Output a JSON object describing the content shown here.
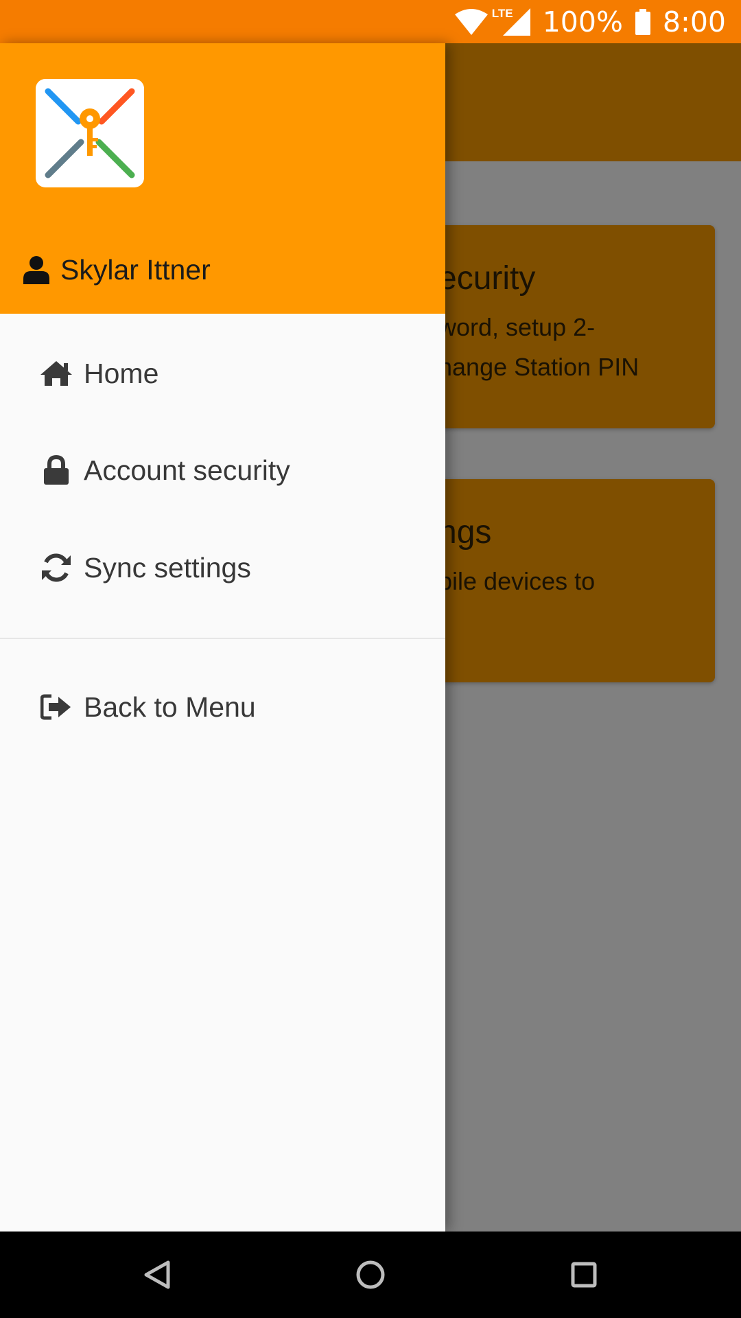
{
  "status_bar": {
    "battery_text": "100%",
    "time": "8:00",
    "network_label": "LTE",
    "icons": [
      "wifi-icon",
      "lte-signal-icon",
      "battery-icon"
    ]
  },
  "drawer": {
    "user_name": "Skylar Ittner",
    "items": [
      {
        "label": "Home",
        "icon": "home-icon"
      },
      {
        "label": "Account security",
        "icon": "lock-icon"
      },
      {
        "label": "Sync settings",
        "icon": "sync-icon"
      }
    ],
    "footer_items": [
      {
        "label": "Back to Menu",
        "icon": "sign-out-icon"
      }
    ]
  },
  "background_cards": [
    {
      "title": "ecurity",
      "lines": [
        "word, setup 2-",
        "hange Station PIN"
      ]
    },
    {
      "title": "ngs",
      "lines": [
        "bile devices to"
      ]
    }
  ],
  "colors": {
    "status_bar": "#f57c00",
    "drawer_header": "#ff9800",
    "dimmed_toolbar": "#7f4f00",
    "scrim": "#808080"
  }
}
